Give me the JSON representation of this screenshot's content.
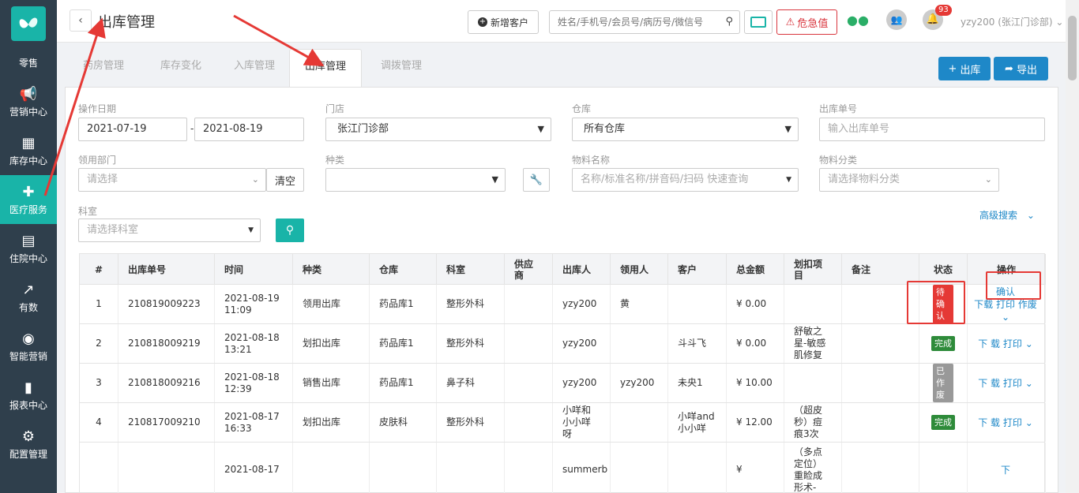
{
  "sidebar": {
    "items": [
      {
        "label": "零售",
        "icon": "retail-icon",
        "glyph": ""
      },
      {
        "label": "营销中心",
        "icon": "megaphone-icon",
        "glyph": "📢"
      },
      {
        "label": "库存中心",
        "icon": "grid-icon",
        "glyph": "▦"
      },
      {
        "label": "医疗服务",
        "icon": "medical-kit-icon",
        "glyph": "✚"
      },
      {
        "label": "住院中心",
        "icon": "building-icon",
        "glyph": "▤"
      },
      {
        "label": "有数",
        "icon": "trend-icon",
        "glyph": "↗"
      },
      {
        "label": "智能营销",
        "icon": "smart-icon",
        "glyph": "◉"
      },
      {
        "label": "报表中心",
        "icon": "bar-chart-icon",
        "glyph": "▮"
      },
      {
        "label": "配置管理",
        "icon": "gear-icon",
        "glyph": "⚙"
      }
    ],
    "active_index": 3
  },
  "header": {
    "title": "出库管理",
    "new_customer": "新增客户",
    "search_placeholder": "姓名/手机号/会员号/病历号/微信号",
    "danger_label": "危急值",
    "notification_count": "93",
    "user": "yzy200 (张江门诊部) ⌄"
  },
  "tabs": [
    "药房管理",
    "库存变化",
    "入库管理",
    "出库管理",
    "调拨管理"
  ],
  "active_tab": 3,
  "actions": {
    "out_label": "出库",
    "export_label": "导出"
  },
  "filters": {
    "op_date_label": "操作日期",
    "date_from": "2021-07-19",
    "date_to": "2021-08-19",
    "store_label": "门店",
    "store_value": "张江门诊部",
    "warehouse_label": "仓库",
    "warehouse_value": "所有仓库",
    "out_no_label": "出库单号",
    "out_no_placeholder": "输入出库单号",
    "dept_label": "领用部门",
    "dept_placeholder": "请选择",
    "clear_label": "清空",
    "kind_label": "种类",
    "kind_value": "",
    "material_label": "物料名称",
    "material_placeholder": "名称/标准名称/拼音码/扫码 快速查询",
    "category_label": "物料分类",
    "category_placeholder": "请选择物料分类",
    "section_label": "科室",
    "section_placeholder": "请选择科室",
    "advanced": "高级搜索"
  },
  "table": {
    "columns": [
      "#",
      "出库单号",
      "时间",
      "种类",
      "仓库",
      "科室",
      "供应商",
      "出库人",
      "领用人",
      "客户",
      "总金额",
      "划扣项目",
      "备注",
      "状态",
      "操作"
    ],
    "rows": [
      {
        "idx": "1",
        "no": "210819009223",
        "time": "2021-08-19 11:09",
        "kind": "领用出库",
        "wh": "药品库1",
        "dept": "整形外科",
        "supplier": "",
        "out_by": "yzy200",
        "recv": "黄",
        "cust": "",
        "amount": "¥ 0.00",
        "item": "",
        "note": "",
        "status": "待确认",
        "status_type": "wait",
        "ops": [
          "确认",
          "下载",
          "打印",
          "作废 ⌄"
        ]
      },
      {
        "idx": "2",
        "no": "210818009219",
        "time": "2021-08-18 13:21",
        "kind": "划扣出库",
        "wh": "药品库1",
        "dept": "整形外科",
        "supplier": "",
        "out_by": "yzy200",
        "recv": "",
        "cust": "斗斗飞",
        "amount": "¥ 0.00",
        "item": "舒敏之星-敏感肌修复",
        "note": "",
        "status": "完成",
        "status_type": "done",
        "ops": [
          "下",
          "载",
          "打印",
          "⌄"
        ]
      },
      {
        "idx": "3",
        "no": "210818009216",
        "time": "2021-08-18 12:39",
        "kind": "销售出库",
        "wh": "药品库1",
        "dept": "鼻子科",
        "supplier": "",
        "out_by": "yzy200",
        "recv": "yzy200",
        "cust": "未央1",
        "amount": "¥ 10.00",
        "item": "",
        "note": "",
        "status": "已作废",
        "status_type": "void",
        "ops": [
          "下",
          "载",
          "打印",
          "⌄"
        ]
      },
      {
        "idx": "4",
        "no": "210817009210",
        "time": "2021-08-17 16:33",
        "kind": "划扣出库",
        "wh": "皮肤科",
        "dept": "整形外科",
        "supplier": "",
        "out_by": "小咩和小小咩呀",
        "recv": "",
        "cust": "小咩and小小咩",
        "amount": "¥ 12.00",
        "item": "（超皮秒）痘痕3次",
        "note": "",
        "status": "完成",
        "status_type": "done",
        "ops": [
          "下",
          "载",
          "打印",
          "⌄"
        ]
      },
      {
        "idx": "",
        "no": "",
        "time": "2021-08-17",
        "kind": "",
        "wh": "",
        "dept": "",
        "supplier": "",
        "out_by": "summerb",
        "recv": "",
        "cust": "",
        "amount": "¥",
        "item": "（多点定位）重睑成形术-",
        "note": "",
        "status": "",
        "status_type": "",
        "ops": [
          "下"
        ]
      }
    ]
  }
}
